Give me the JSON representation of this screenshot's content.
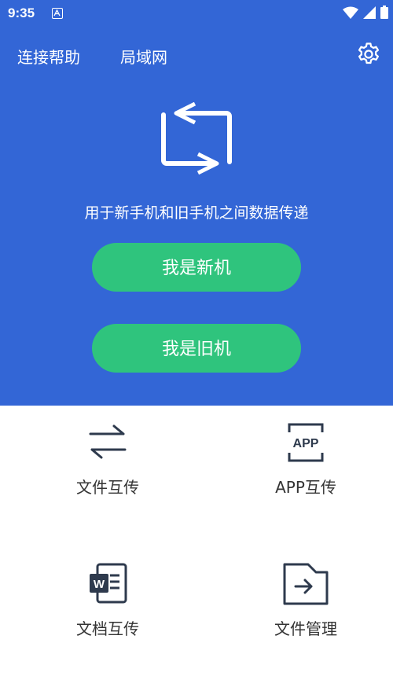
{
  "status_bar": {
    "time": "9:35"
  },
  "header": {
    "help_link": "连接帮助",
    "lan_link": "局域网"
  },
  "hero": {
    "tagline": "用于新手机和旧手机之间数据传递"
  },
  "buttons": {
    "new_phone": "我是新机",
    "old_phone": "我是旧机"
  },
  "features": [
    {
      "label": "文件互传",
      "icon": "swap-arrows-icon"
    },
    {
      "label": "APP互传",
      "icon": "app-icon",
      "icon_text": "APP"
    },
    {
      "label": "文档互传",
      "icon": "word-document-icon",
      "icon_text": "W"
    },
    {
      "label": "文件管理",
      "icon": "folder-arrow-icon"
    }
  ],
  "colors": {
    "primary_blue": "#3366d6",
    "button_green": "#2fc47d",
    "icon_dark": "#2e3a4d"
  }
}
